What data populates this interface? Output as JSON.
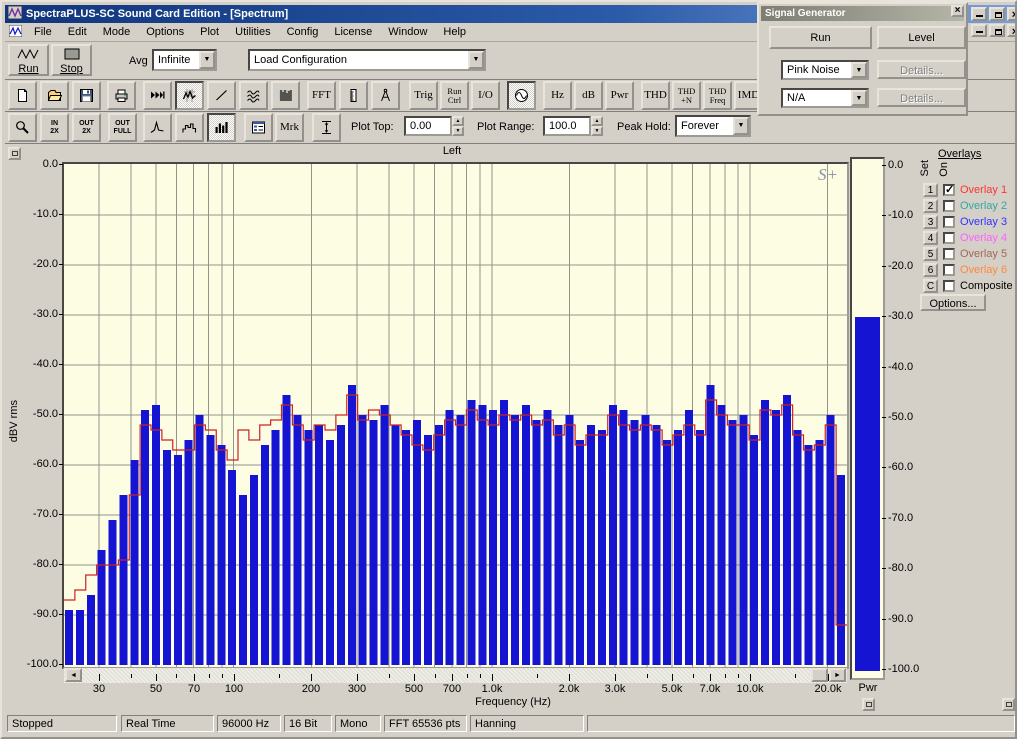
{
  "window": {
    "title": "SpectraPLUS-SC Sound Card Edition - [Spectrum]"
  },
  "menu": {
    "items": [
      "File",
      "Edit",
      "Mode",
      "Options",
      "Plot",
      "Utilities",
      "Config",
      "License",
      "Window",
      "Help"
    ]
  },
  "toolbar_main": {
    "run_label": "Run",
    "stop_label": "Stop",
    "avg_label": "Avg",
    "avg_value": "Infinite",
    "config_value": "Load Configuration"
  },
  "toolbar_views": {
    "buttons": [
      {
        "name": "new-file-button",
        "icon": "new-document-icon"
      },
      {
        "name": "open-file-button",
        "icon": "open-folder-icon"
      },
      {
        "name": "save-button",
        "icon": "save-icon"
      },
      {
        "name": "print-button",
        "icon": "printer-icon"
      },
      {
        "name": "time-series-view-button",
        "icon": "time-series-icon"
      },
      {
        "name": "spectrum-view-button",
        "icon": "spectrum-plot-icon",
        "pressed": true
      },
      {
        "name": "phase-view-button",
        "icon": "phase-line-icon"
      },
      {
        "name": "waterfall-view-button",
        "icon": "waterfall-icon"
      },
      {
        "name": "spectrogram-view-button",
        "icon": "spectrogram-icon"
      },
      {
        "name": "fft-settings-button",
        "label": "FFT"
      },
      {
        "name": "calibration-button",
        "icon": "ruler-icon"
      },
      {
        "name": "processing-settings-button",
        "icon": "compass-icon"
      },
      {
        "name": "trigger-button",
        "label": "Trig"
      },
      {
        "name": "run-control-button",
        "label": "Run",
        "label2": "Ctrl"
      },
      {
        "name": "io-device-button",
        "label": "I/O"
      },
      {
        "name": "signal-generator-button",
        "icon": "sine-wave-icon",
        "pressed": true
      },
      {
        "name": "hz-units-button",
        "label": "Hz"
      },
      {
        "name": "db-units-button",
        "label": "dB"
      },
      {
        "name": "pwr-units-button",
        "label": "Pwr"
      },
      {
        "name": "thd-button",
        "label": "THD"
      },
      {
        "name": "thd-n-button",
        "label": "THD",
        "label2": "+N"
      },
      {
        "name": "thd-freq-button",
        "label": "THD",
        "label2": "Freq"
      },
      {
        "name": "imd-button",
        "label": "IMD"
      }
    ]
  },
  "toolbar_plot": {
    "buttons": [
      {
        "name": "zoom-button",
        "icon": "magnifier-icon"
      },
      {
        "name": "input-2x-button",
        "label": "IN",
        "label2": "2X"
      },
      {
        "name": "output-2x-button",
        "label": "OUT",
        "label2": "2X"
      },
      {
        "name": "output-full-button",
        "label": "OUT",
        "label2": "FULL"
      },
      {
        "name": "peak-spectrum-button",
        "icon": "peak-curve-icon"
      },
      {
        "name": "step-spectrum-button",
        "icon": "step-plot-icon"
      },
      {
        "name": "bar-spectrum-button",
        "icon": "bar-plot-icon",
        "pressed": true
      },
      {
        "name": "display-options-button",
        "icon": "list-options-icon"
      },
      {
        "name": "marker-button",
        "label": "Mrk"
      },
      {
        "name": "autoscale-button",
        "icon": "vertical-scale-icon"
      }
    ],
    "plot_top_label": "Plot Top:",
    "plot_top_value": "0.00",
    "plot_range_label": "Plot Range:",
    "plot_range_value": "100.0",
    "peak_hold_label": "Peak Hold:",
    "peak_hold_value": "Forever"
  },
  "signal_generator": {
    "title": "Signal Generator",
    "run_label": "Run",
    "level_label": "Level",
    "waveform_value": "Pink Noise",
    "waveform2_value": "N/A",
    "details_label": "Details...",
    "details2_label": "Details..."
  },
  "plot": {
    "title": "Left",
    "ylabel": "dBV rms",
    "xlabel": "Frequency (Hz)",
    "watermark": "S+"
  },
  "overlays": {
    "heading": "Overlays",
    "set_label": "Set",
    "on_label": "On",
    "items": [
      {
        "id": "1",
        "label": "Overlay 1",
        "color": "#ff3232",
        "checked": true
      },
      {
        "id": "2",
        "label": "Overlay 2",
        "color": "#2fa8a0",
        "checked": false
      },
      {
        "id": "3",
        "label": "Overlay 3",
        "color": "#3232ff",
        "checked": false
      },
      {
        "id": "4",
        "label": "Overlay 4",
        "color": "#ff5fff",
        "checked": false
      },
      {
        "id": "5",
        "label": "Overlay 5",
        "color": "#a06858",
        "checked": false
      },
      {
        "id": "6",
        "label": "Overlay 6",
        "color": "#ff8838",
        "checked": false
      },
      {
        "id": "C",
        "label": "Composite",
        "color": "#000000",
        "checked": false
      }
    ],
    "options_label": "Options..."
  },
  "power_meter": {
    "label": "Pwr",
    "value_db": -30.5
  },
  "status_bar": {
    "panels": [
      "Stopped",
      "Real Time",
      "96000 Hz",
      "16 Bit",
      "Mono",
      "FFT 65536 pts",
      "Hanning",
      ""
    ]
  },
  "chart_data": {
    "type": "bar",
    "title": "Left",
    "xlabel": "Frequency (Hz)",
    "ylabel": "dBV rms",
    "x_scale": "log",
    "x_range_hz": [
      22,
      23800
    ],
    "ylim": [
      -100,
      0
    ],
    "grid": true,
    "y_tick_labels": [
      "0.0",
      "-10.0",
      "-20.0",
      "-30.0",
      "-40.0",
      "-50.0",
      "-60.0",
      "-70.0",
      "-80.0",
      "-90.0",
      "-100.0"
    ],
    "x_ticks": [
      {
        "label": "30",
        "f": 30
      },
      {
        "label": "50",
        "f": 50
      },
      {
        "label": "70",
        "f": 70
      },
      {
        "label": "100",
        "f": 100
      },
      {
        "label": "200",
        "f": 200
      },
      {
        "label": "300",
        "f": 300
      },
      {
        "label": "500",
        "f": 500
      },
      {
        "label": "700",
        "f": 700
      },
      {
        "label": "1.0k",
        "f": 1000
      },
      {
        "label": "2.0k",
        "f": 2000
      },
      {
        "label": "3.0k",
        "f": 3000
      },
      {
        "label": "5.0k",
        "f": 5000
      },
      {
        "label": "7.0k",
        "f": 7000
      },
      {
        "label": "10.0k",
        "f": 10000
      },
      {
        "label": "20.0k",
        "f": 20000
      }
    ],
    "x_minor_ticks": [
      40,
      60,
      80,
      90,
      150,
      400,
      600,
      800,
      900,
      1500,
      4000,
      6000,
      8000,
      9000,
      15000
    ],
    "grid_freqs": [
      30,
      40,
      50,
      60,
      70,
      80,
      90,
      100,
      200,
      300,
      400,
      500,
      600,
      700,
      800,
      900,
      1000,
      2000,
      3000,
      4000,
      5000,
      6000,
      7000,
      8000,
      9000,
      10000,
      20000
    ],
    "series": [
      {
        "name": "live-spectrum",
        "type": "bar",
        "color": "#1414d2",
        "values_db": [
          -89,
          -89,
          -86,
          -77,
          -71,
          -66,
          -59,
          -49,
          -48,
          -57,
          -58,
          -55,
          -50,
          -54,
          -56,
          -61,
          -66,
          -62,
          -56,
          -53,
          -46,
          -50,
          -53,
          -52,
          -55,
          -52,
          -44,
          -50,
          -51,
          -48,
          -52,
          -53,
          -51,
          -54,
          -52,
          -49,
          -50,
          -47,
          -48,
          -49,
          -47,
          -50,
          -48,
          -51,
          -49,
          -52,
          -50,
          -55,
          -52,
          -53,
          -48,
          -49,
          -51,
          -50,
          -52,
          -55,
          -53,
          -49,
          -53,
          -44,
          -48,
          -51,
          -50,
          -54,
          -47,
          -49,
          -46,
          -53,
          -56,
          -55,
          -50,
          -62
        ]
      },
      {
        "name": "overlay-1-trace",
        "type": "step",
        "color": "#cc2222",
        "values_db": [
          -87,
          -85,
          -82,
          -80,
          -80,
          -79,
          -66,
          -52,
          -53,
          -55,
          -57,
          -57,
          -52,
          -53,
          -57,
          -59,
          -53,
          -55,
          -52,
          -51,
          -48,
          -52,
          -55,
          -52,
          -53,
          -50,
          -46,
          -51,
          -49,
          -50,
          -52,
          -54,
          -56,
          -57,
          -54,
          -51,
          -52,
          -49,
          -51,
          -52,
          -50,
          -51,
          -50,
          -52,
          -51,
          -54,
          -52,
          -56,
          -54,
          -54,
          -50,
          -52,
          -53,
          -52,
          -53,
          -56,
          -54,
          -52,
          -54,
          -47,
          -50,
          -52,
          -52,
          -55,
          -49,
          -50,
          -48,
          -54,
          -57,
          -56,
          -52,
          -92
        ]
      }
    ]
  }
}
